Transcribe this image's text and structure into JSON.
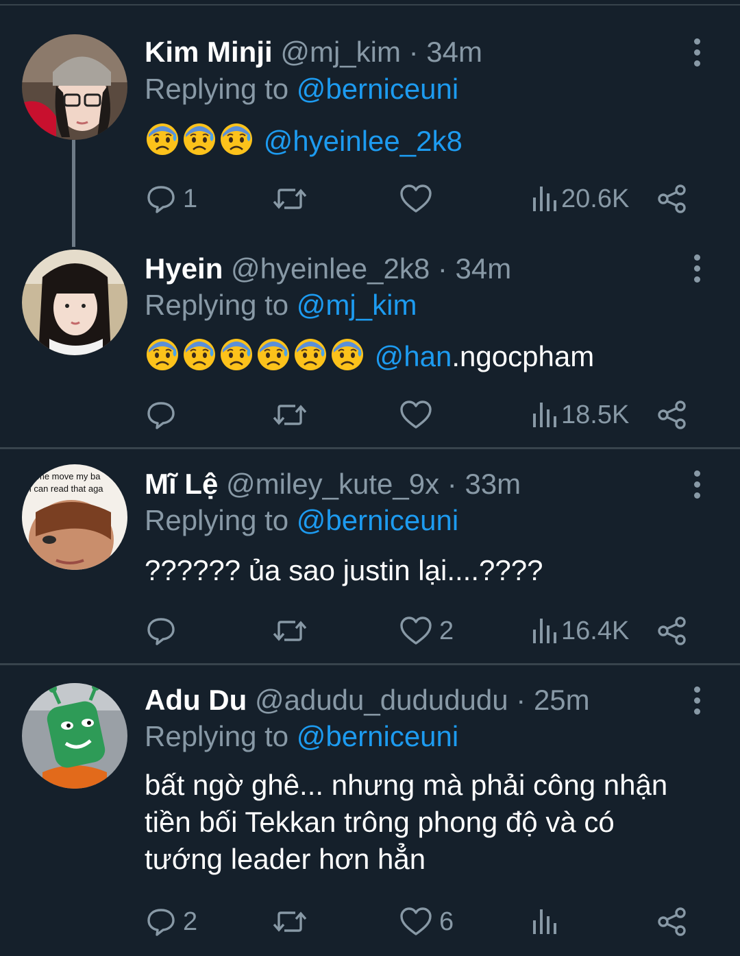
{
  "colors": {
    "background": "#15202b",
    "link": "#1d9bf0",
    "muted": "#8899a6",
    "divider": "#38444d"
  },
  "tweets": [
    {
      "name": "Kim Minji",
      "handle": "@mj_kim",
      "time": "· 34m",
      "replying_label": "Replying to",
      "replying_to": "@berniceuni",
      "body_mention": "@hyeinlee_2k8",
      "emoji_count": 3,
      "reply_count": "1",
      "retweet_count": "",
      "like_count": "",
      "views": "20.6K"
    },
    {
      "name": "Hyein",
      "handle": "@hyeinlee_2k8",
      "time": "· 34m",
      "replying_label": "Replying to",
      "replying_to": "@mj_kim",
      "body_mention_link": "@han",
      "body_mention_rest": ".ngocpham",
      "emoji_count": 6,
      "reply_count": "",
      "retweet_count": "",
      "like_count": "",
      "views": "18.5K"
    },
    {
      "name": "Mĩ Lệ",
      "handle": "@miley_kute_9x",
      "time": "· 33m",
      "replying_label": "Replying to",
      "replying_to": "@berniceuni",
      "body": "?????? ủa sao justin lại....????",
      "avatar_caption_line1": "me move my ba",
      "avatar_caption_line2": "o i can read that aga",
      "reply_count": "",
      "retweet_count": "",
      "like_count": "2",
      "views": "16.4K"
    },
    {
      "name": "Adu Du",
      "handle": "@adudu_dudududu",
      "time": "· 25m",
      "replying_label": "Replying to",
      "replying_to": "@berniceuni",
      "body_lines": [
        "bất ngờ ghê... nhưng mà phải công nhận",
        "tiền bối Tekkan trông phong độ và có",
        "tướng leader hơn hẳn"
      ],
      "reply_count": "2",
      "retweet_count": "",
      "like_count": "6",
      "views": ""
    }
  ],
  "icons": [
    "reply-icon",
    "retweet-icon",
    "like-icon",
    "views-icon",
    "share-icon",
    "more-options-icon",
    "anxious-sweat-emoji"
  ]
}
